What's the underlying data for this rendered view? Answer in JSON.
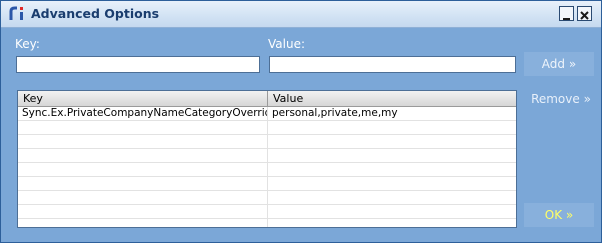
{
  "window": {
    "title": "Advanced Options",
    "app_icon": "ri-logo-icon",
    "minimize_icon": "minimize-icon",
    "close_icon": "close-icon"
  },
  "form": {
    "key_label": "Key:",
    "value_label": "Value:",
    "key_value": "",
    "value_value": ""
  },
  "buttons": {
    "add_label": "Add »",
    "remove_label": "Remove »",
    "ok_label": "OK »"
  },
  "table": {
    "columns": [
      "Key",
      "Value"
    ],
    "rows": [
      {
        "key": "Sync.Ex.PrivateCompanyNameCategoryOverride",
        "value": "personal,private,me,my"
      },
      {
        "key": "",
        "value": ""
      },
      {
        "key": "",
        "value": ""
      },
      {
        "key": "",
        "value": ""
      },
      {
        "key": "",
        "value": ""
      },
      {
        "key": "",
        "value": ""
      },
      {
        "key": "",
        "value": ""
      },
      {
        "key": "",
        "value": ""
      },
      {
        "key": "",
        "value": ""
      }
    ]
  },
  "colors": {
    "window_bg": "#7ba7d7",
    "title_text": "#1a3d6e",
    "ok_text": "#ffff66"
  }
}
